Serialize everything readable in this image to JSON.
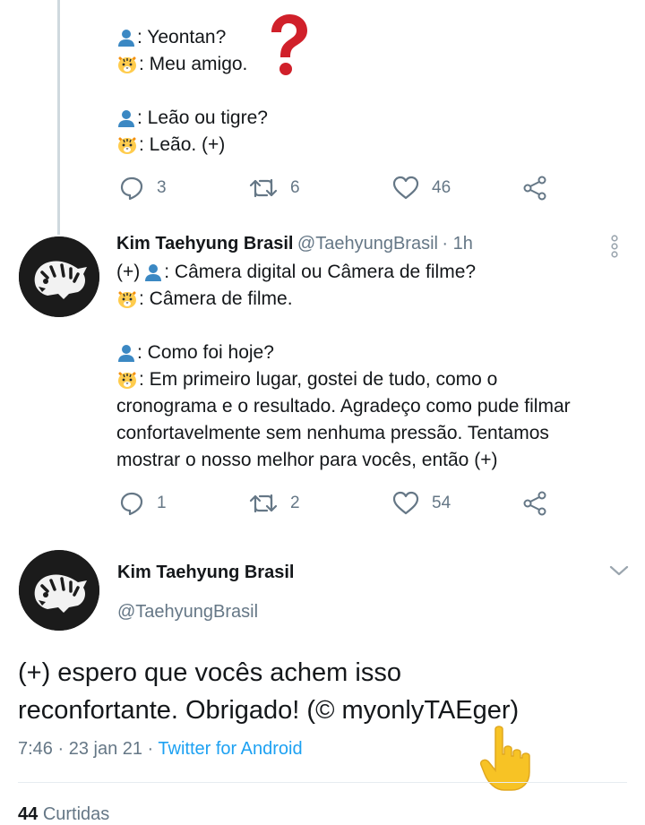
{
  "tweet1": {
    "lines": [
      {
        "emoji": "person",
        "text": ": Yeontan?"
      },
      {
        "emoji": "tiger",
        "text": ": Meu amigo."
      },
      {
        "emoji": "",
        "text": ""
      },
      {
        "emoji": "person",
        "text": ": Leão ou tigre?"
      },
      {
        "emoji": "tiger",
        "text": ": Leão. (+)"
      }
    ],
    "replies": "3",
    "retweets": "6",
    "likes": "46"
  },
  "tweet2": {
    "name": "Kim Taehyung Brasil",
    "handle": "@TaehyungBrasil",
    "time": "· 1h",
    "lines": [
      {
        "prefix": "(+) ",
        "emoji": "person",
        "text": ": Câmera digital ou Câmera de filme?"
      },
      {
        "prefix": "",
        "emoji": "tiger",
        "text": ": Câmera de filme."
      },
      {
        "prefix": "",
        "emoji": "",
        "text": ""
      },
      {
        "prefix": "",
        "emoji": "person",
        "text": ": Como foi hoje?"
      },
      {
        "prefix": "",
        "emoji": "tiger",
        "text": ": Em primeiro lugar, gostei de tudo, como o"
      },
      {
        "prefix": "",
        "emoji": "",
        "text": "cronograma e o resultado. Agradeço como pude filmar"
      },
      {
        "prefix": "",
        "emoji": "",
        "text": "confortavelmente sem nenhuma pressão. Tentamos"
      },
      {
        "prefix": "",
        "emoji": "",
        "text": "mostrar o nosso melhor para vocês, então (+)"
      }
    ],
    "replies": "1",
    "retweets": "2",
    "likes": "54"
  },
  "tweet3": {
    "name": "Kim Taehyung Brasil",
    "handle": "@TaehyungBrasil",
    "text_line1": "(+) espero que vocês achem isso",
    "text_line2": "reconfortante. Obrigado! (© myonlyTAEger)",
    "time": "7:46 · 23 jan 21 · ",
    "source": "Twitter for Android",
    "likes_count": "44",
    "likes_label": "Curtidas"
  },
  "overlays": {
    "question_mark": "?",
    "question_color": "#d0202a",
    "hand_color": "#f7c325"
  },
  "icons": {
    "person": "bust-in-silhouette-icon",
    "tiger": "tiger-face-icon",
    "reply": "reply-icon",
    "retweet": "retweet-icon",
    "like": "heart-icon",
    "share": "share-icon",
    "more": "more-vertical-icon",
    "chevron": "chevron-down-icon"
  }
}
